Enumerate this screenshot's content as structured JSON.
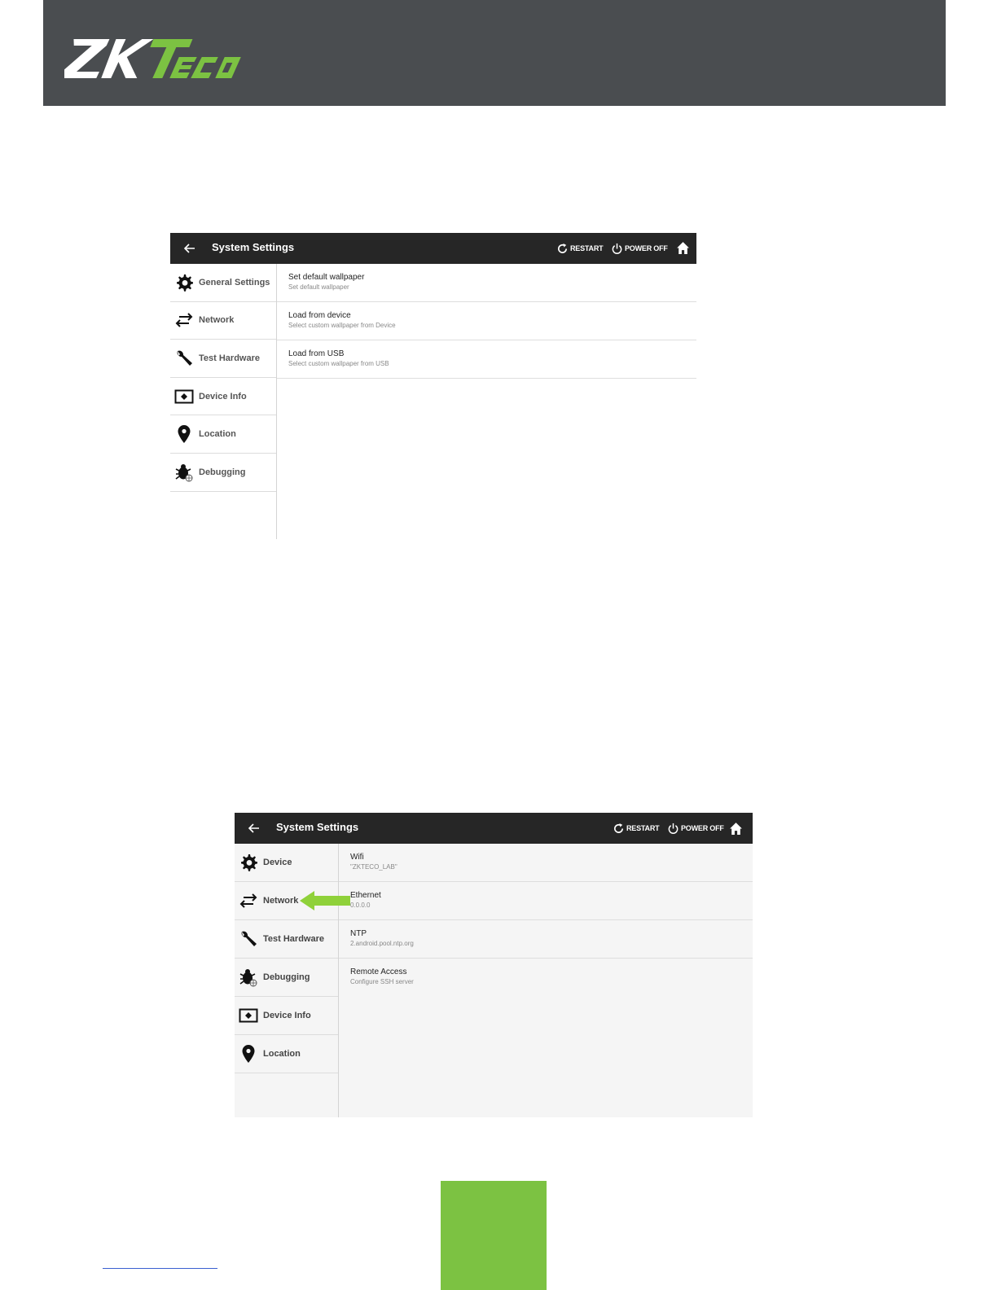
{
  "brand": {
    "logo_text": "ZKTeco",
    "colors": {
      "header_bg": "#4a4d50",
      "accent": "#7cc242"
    }
  },
  "screenshot1": {
    "topbar": {
      "title": "System Settings",
      "restart": "RESTART",
      "poweroff": "POWER OFF"
    },
    "sidebar": [
      {
        "label": "General Settings",
        "icon": "gear-icon"
      },
      {
        "label": "Network",
        "icon": "arrows-icon"
      },
      {
        "label": "Test Hardware",
        "icon": "wrench-icon"
      },
      {
        "label": "Device Info",
        "icon": "device-icon"
      },
      {
        "label": "Location",
        "icon": "location-pin-icon"
      },
      {
        "label": "Debugging",
        "icon": "bug-icon"
      }
    ],
    "rows": [
      {
        "title": "Set default wallpaper",
        "subtitle": "Set default wallpaper"
      },
      {
        "title": "Load from device",
        "subtitle": "Select custom wallpaper from Device"
      },
      {
        "title": "Load from USB",
        "subtitle": "Select custom wallpaper from USB"
      }
    ]
  },
  "screenshot2": {
    "topbar": {
      "title": "System Settings",
      "restart": "RESTART",
      "poweroff": "POWER OFF"
    },
    "sidebar": [
      {
        "label": "Device",
        "icon": "gear-icon"
      },
      {
        "label": "Network",
        "icon": "arrows-icon"
      },
      {
        "label": "Test Hardware",
        "icon": "wrench-icon"
      },
      {
        "label": "Debugging",
        "icon": "bug-icon"
      },
      {
        "label": "Device Info",
        "icon": "device-icon"
      },
      {
        "label": "Location",
        "icon": "location-pin-icon"
      }
    ],
    "rows": [
      {
        "title": "Wifi",
        "subtitle": "\"ZKTECO_LAB\""
      },
      {
        "title": "Ethernet",
        "subtitle": "0.0.0.0"
      },
      {
        "title": "NTP",
        "subtitle": "2.android.pool.ntp.org"
      },
      {
        "title": "Remote Access",
        "subtitle": "Configure SSH server"
      }
    ]
  }
}
